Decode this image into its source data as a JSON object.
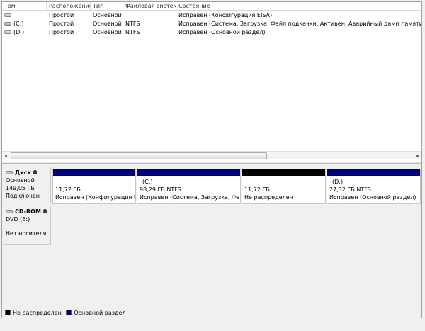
{
  "columns": [
    "Том",
    "Расположение",
    "Тип",
    "Файловая система",
    "Состояние"
  ],
  "volumes": [
    {
      "name": "",
      "layout": "Простой",
      "type": "Основной",
      "fs": "",
      "status": "Исправен (Конфигурация EISA)"
    },
    {
      "name": "(C:)",
      "layout": "Простой",
      "type": "Основной",
      "fs": "NTFS",
      "status": "Исправен (Система, Загрузка, Файл подкачки, Активен, Аварийный дамп памяти, Основной"
    },
    {
      "name": "(D:)",
      "layout": "Простой",
      "type": "Основной",
      "fs": "NTFS",
      "status": "Исправен (Основной раздел)"
    }
  ],
  "disk0": {
    "name": "Диск 0",
    "type": "Основной",
    "size": "149,05 ГБ",
    "state": "Подключен",
    "partitions": [
      {
        "label": "",
        "size": "11,72 ГБ",
        "status": "Исправен (Конфигурация EISA)",
        "color": "#00007f"
      },
      {
        "label": "(C:)",
        "size": "98,29 ГБ NTFS",
        "status": "Исправен (Система, Загрузка, Файл подкачки...",
        "color": "#00007f"
      },
      {
        "label": "",
        "size": "11,72 ГБ",
        "status": "Не распределен",
        "color": "#000000"
      },
      {
        "label": "(D:)",
        "size": "27,32 ГБ NTFS",
        "status": "Исправен (Основной раздел)",
        "color": "#00007f"
      }
    ]
  },
  "cdrom": {
    "name": "CD-ROM 0",
    "drive": "DVD (E:)",
    "state": "Нет носителя"
  },
  "legend": [
    {
      "label": "Не распределен",
      "color": "#000000"
    },
    {
      "label": "Основной раздел",
      "color": "#00007f"
    }
  ]
}
